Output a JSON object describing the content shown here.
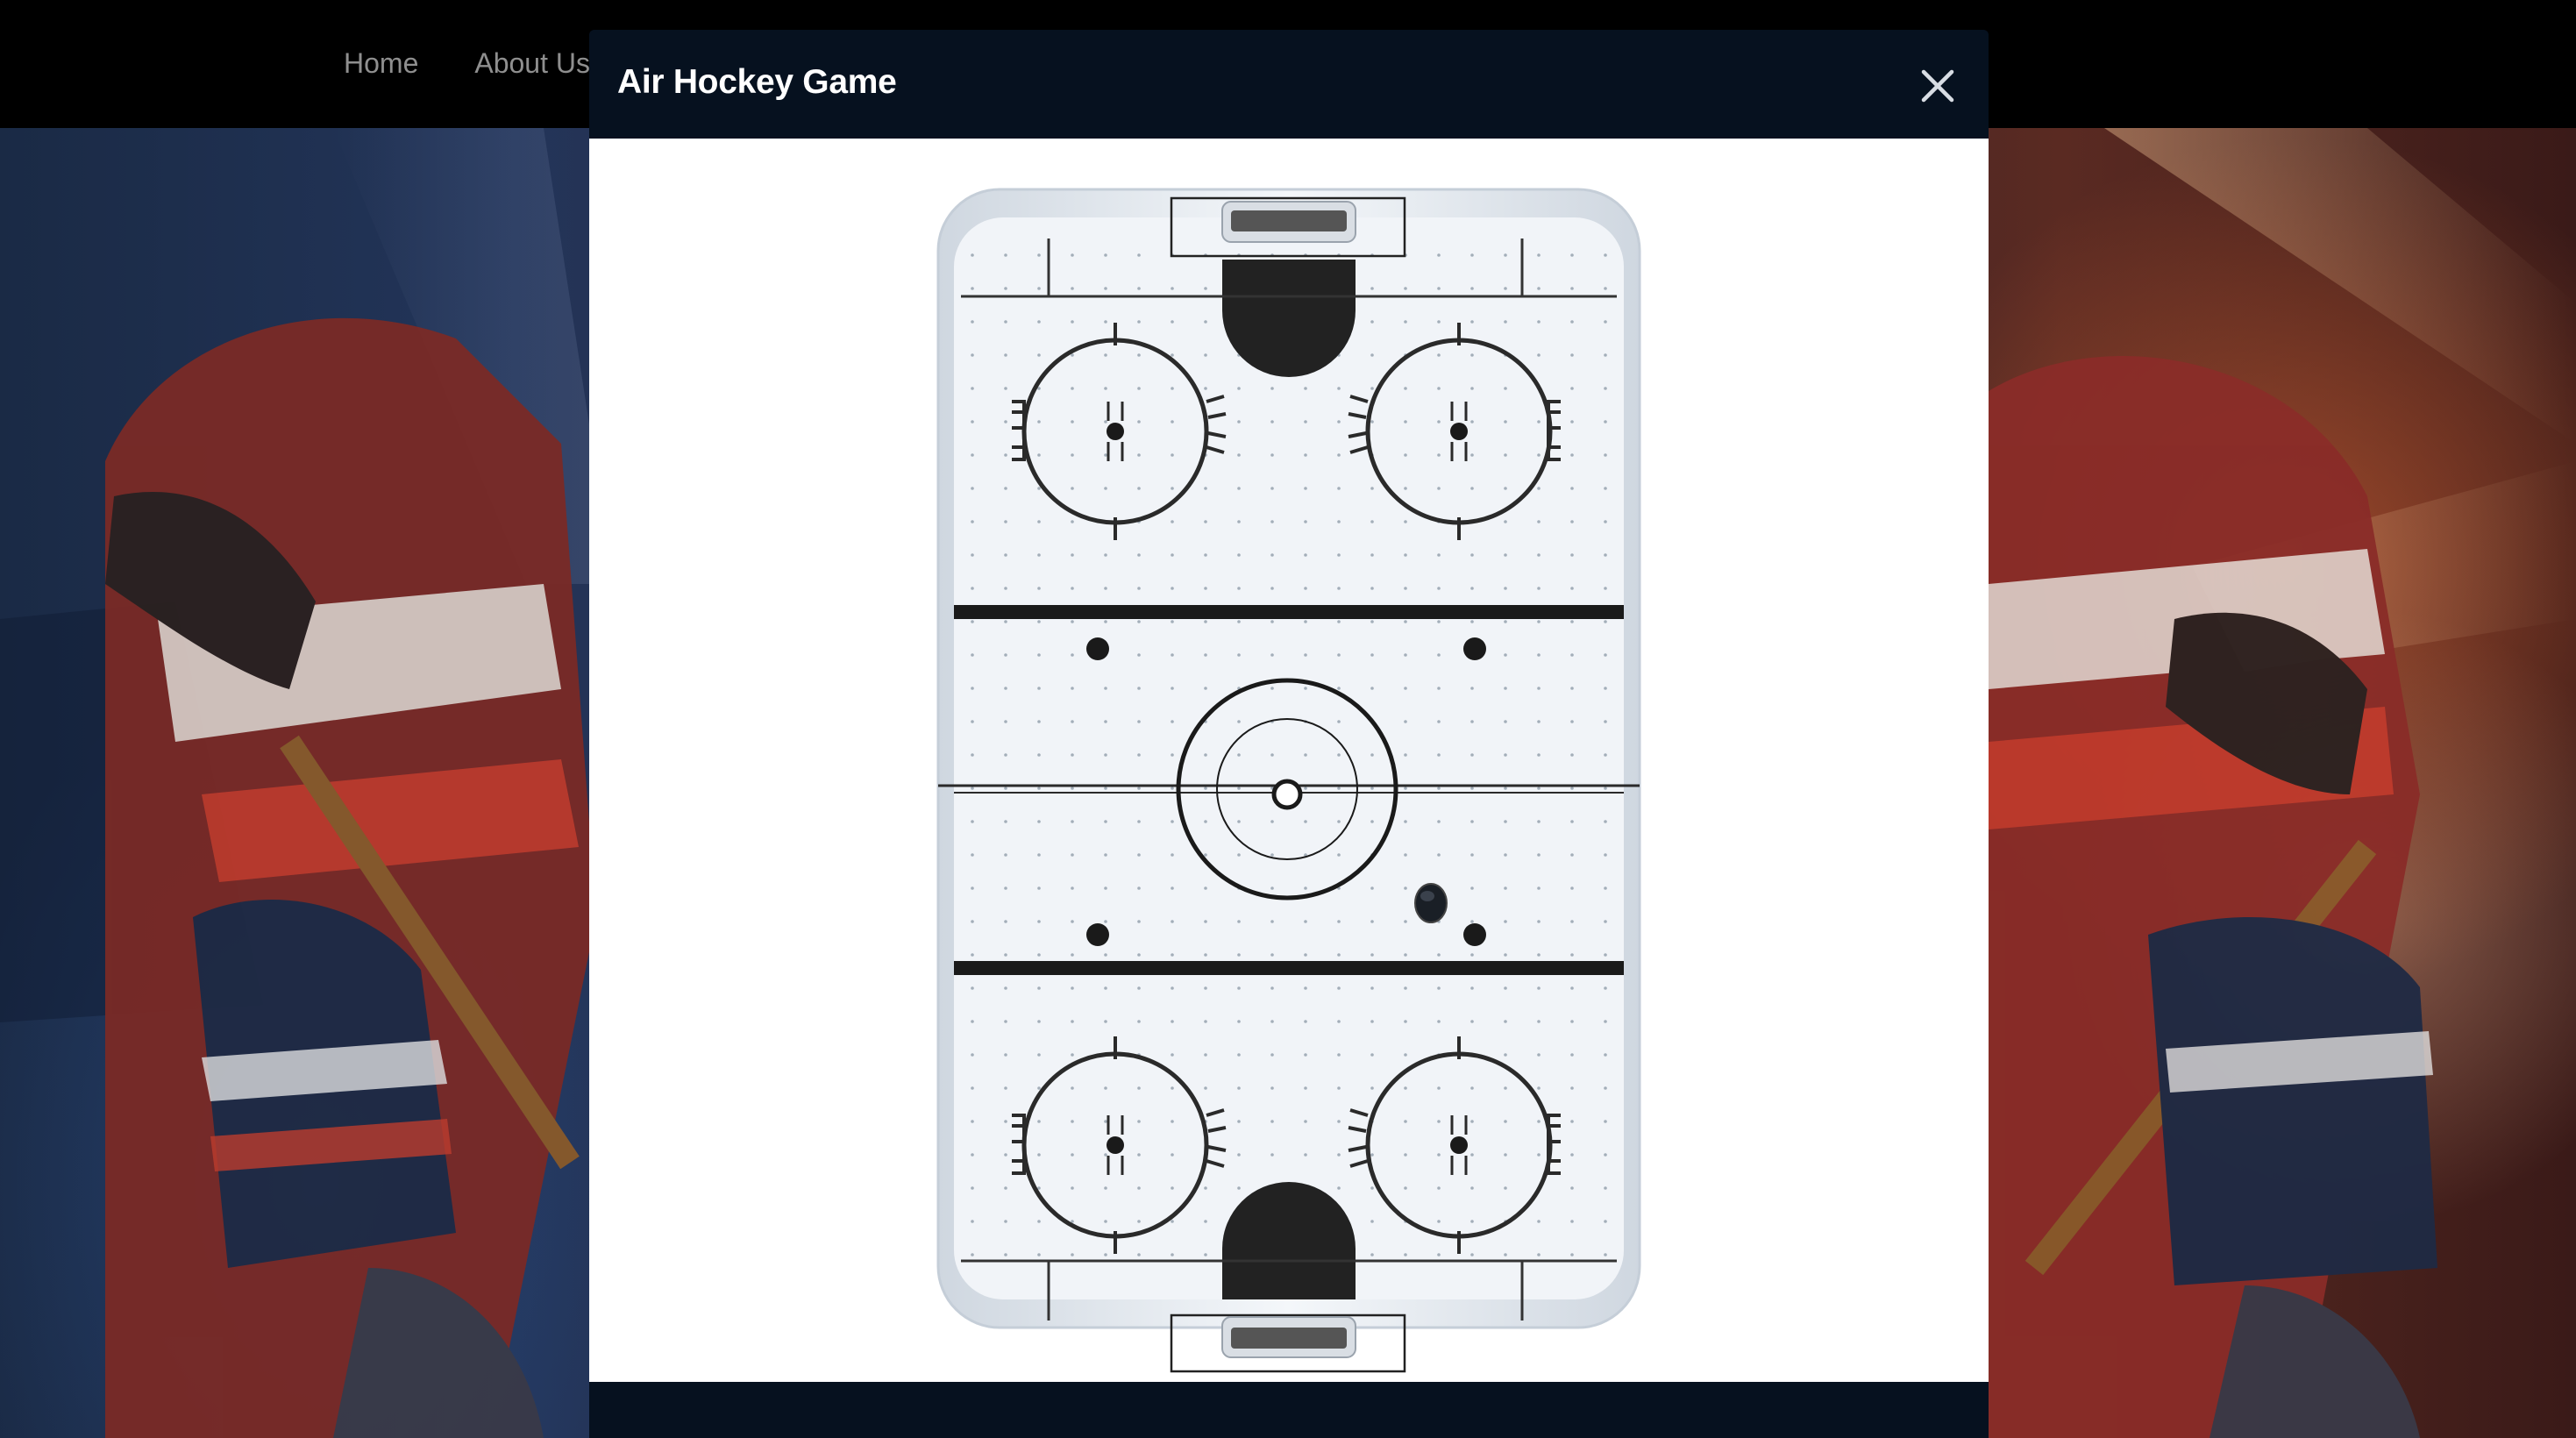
{
  "nav": {
    "items": [
      {
        "label": "Home"
      },
      {
        "label": "About Us"
      }
    ]
  },
  "modal": {
    "title": "Air Hockey Game",
    "close_icon": "close-icon"
  },
  "colors": {
    "modal_header": "#06111f",
    "navbar": "#000000",
    "nav_text": "#8f8f8f",
    "rink_line": "#1a1a1a",
    "rink_surface": "#eef2f7",
    "rink_border": "#c9d2dc"
  }
}
